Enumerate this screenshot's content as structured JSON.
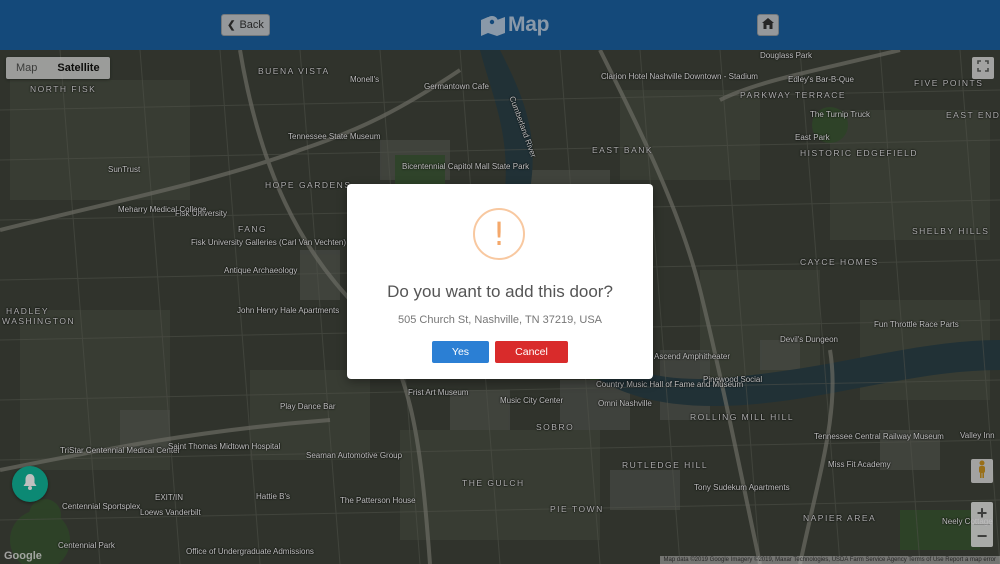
{
  "header": {
    "back_label": "Back",
    "title": "Map",
    "back_icon": "chevron-left-icon",
    "home_icon": "home-icon",
    "brand_icon": "map-marker-icon",
    "color": "#1b62a3"
  },
  "map": {
    "type_options": [
      "Map",
      "Satellite"
    ],
    "selected_type": "Satellite",
    "google_label": "Google",
    "attribution": "Map data ©2019 Google Imagery ©2019, Maxar Technologies, USDA Farm Service Agency   Terms of Use   Report a map error",
    "zoom_in": "+",
    "zoom_out": "−",
    "labels": {
      "north_fisk": "NORTH FISK",
      "buena_vista": "BUENA VISTA",
      "hope_gardens": "HOPE GARDENS",
      "fang": "FANG",
      "hadley": "HADLEY",
      "washington": "WASHINGTON",
      "east_bank": "EAST BANK",
      "parkway_terrace": "PARKWAY TERRACE",
      "historic_edgefield": "HISTORIC EDGEFIELD",
      "five_points": "FIVE POINTS",
      "east_end": "EAST END",
      "shelby_hills": "SHELBY HILLS",
      "cayce_homes": "CAYCE HOMES",
      "sobro": "SOBRO",
      "rolling_mill_hill": "ROLLING MILL HILL",
      "rutledge_hill": "RUTLEDGE HILL",
      "the_gulch": "THE GULCH",
      "pie_town": "PIE TOWN",
      "napier_area": "NAPIER AREA",
      "fisk_university": "Fisk University",
      "tennessee_state_museum": "Tennessee State Museum",
      "germantown_cafe": "Germantown Cafe",
      "cumberland_river": "Cumberland River",
      "clarion_hotel": "Clarion Hotel Nashville Downtown - Stadium",
      "first_art_museum": "Frist Art Museum",
      "music_city_center": "Music City Center",
      "ascend_amphitheater": "Ascend Amphitheater",
      "pinewood_social": "Pinewood Social",
      "devils_dungeon": "Devil's Dungeon",
      "fun_throttle": "Fun Throttle Race Parts",
      "tristar_centennial": "TriStar Centennial Medical Center",
      "saint_thomas": "Saint Thomas Midtown Hospital",
      "centennial_park": "Centennial Park",
      "tennessee_central": "Tennessee Central Railway Museum",
      "miss_fit": "Miss Fit Academy",
      "tony_sudekum": "Tony Sudekum Apartments",
      "the_patterson_house": "The Patterson House",
      "loews_vanderbilt": "Loews Vanderbilt",
      "exit_in": "EXIT/IN",
      "antique_archaeology": "Antique Archaeology",
      "john_henry": "John Henry Hale Apartments",
      "play_dance_bar": "Play Dance Bar",
      "seaman_automotive": "Seaman Automotive Group",
      "hattie_bs": "Hattie B's",
      "office_undergrad": "Office of Undergraduate Admissions",
      "meharry": "Meharry Medical College",
      "fisk_galleries": "Fisk University Galleries (Carl Van Vechten)",
      "bicentennial_park": "Bicentennial Capitol Mall State Park",
      "sun_trust": "SunTrust",
      "country_hall": "Country Music Hall of Fame and Museum",
      "omni": "Omni Nashville",
      "the_turnip_truck": "The Turnip Truck",
      "edleys": "Edley's Bar-B-Que",
      "douglass_park": "Douglass Park",
      "east_park": "East Park",
      "monells": "Monell's",
      "valley_inn": "Valley Inn",
      "neely": "Neely Cottage",
      "centennial_sportsplex": "Centennial Sportsplex"
    }
  },
  "dialog": {
    "icon": "exclamation-circle-icon",
    "icon_glyph": "!",
    "title": "Do you want to add this door?",
    "address": "505 Church St, Nashville, TN 37219, USA",
    "yes_label": "Yes",
    "cancel_label": "Cancel",
    "yes_color": "#2b7fd4",
    "cancel_color": "#d92b2b"
  },
  "notification_icon": "bell-icon"
}
